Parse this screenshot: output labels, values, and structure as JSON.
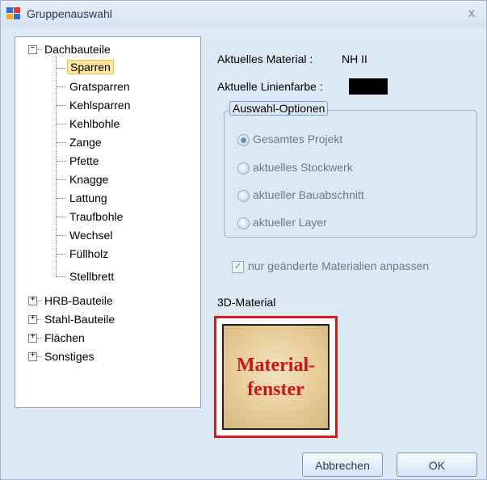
{
  "window": {
    "title": "Gruppenauswahl",
    "close_label": "x"
  },
  "tree": {
    "items": [
      {
        "label": "Dachbauteile",
        "expander": "−",
        "expanded": true,
        "children": [
          "Sparren",
          "Gratsparren",
          "Kehlsparren",
          "Kehlbohle",
          "Zange",
          "Pfette",
          "Knagge",
          "Lattung",
          "Traufbohle",
          "Wechsel",
          "Füllholz",
          "Stellbrett"
        ],
        "selected_child": "Sparren"
      },
      {
        "label": "HRB-Bauteile",
        "expander": "+"
      },
      {
        "label": "Stahl-Bauteile",
        "expander": "+"
      },
      {
        "label": "Flächen",
        "expander": "+"
      },
      {
        "label": "Sonstiges",
        "expander": "+"
      }
    ]
  },
  "info": {
    "material_label": "Aktuelles Material :",
    "material_value": "NH II",
    "line_color_label": "Aktuelle Linienfarbe :",
    "line_color": "#000000"
  },
  "options": {
    "group_title": "Auswahl-Optionen",
    "radios": [
      {
        "label": "Gesamtes Projekt",
        "checked": true
      },
      {
        "label": "aktuelles Stockwerk",
        "checked": false
      },
      {
        "label": "aktueller Bauabschnitt",
        "checked": false
      },
      {
        "label": "aktueller Layer",
        "checked": false
      }
    ],
    "checkbox_label": "nur geänderte Materialien anpassen",
    "checkbox_checked": true
  },
  "material3d": {
    "label": "3D-Material",
    "preview_line1": "Material-",
    "preview_line2": "fenster"
  },
  "buttons": {
    "cancel": "Abbrechen",
    "ok": "OK"
  },
  "colors": {
    "highlight_border": "#e01818",
    "selection": "#ffe7a0",
    "window_bg": "#dde8f5"
  }
}
